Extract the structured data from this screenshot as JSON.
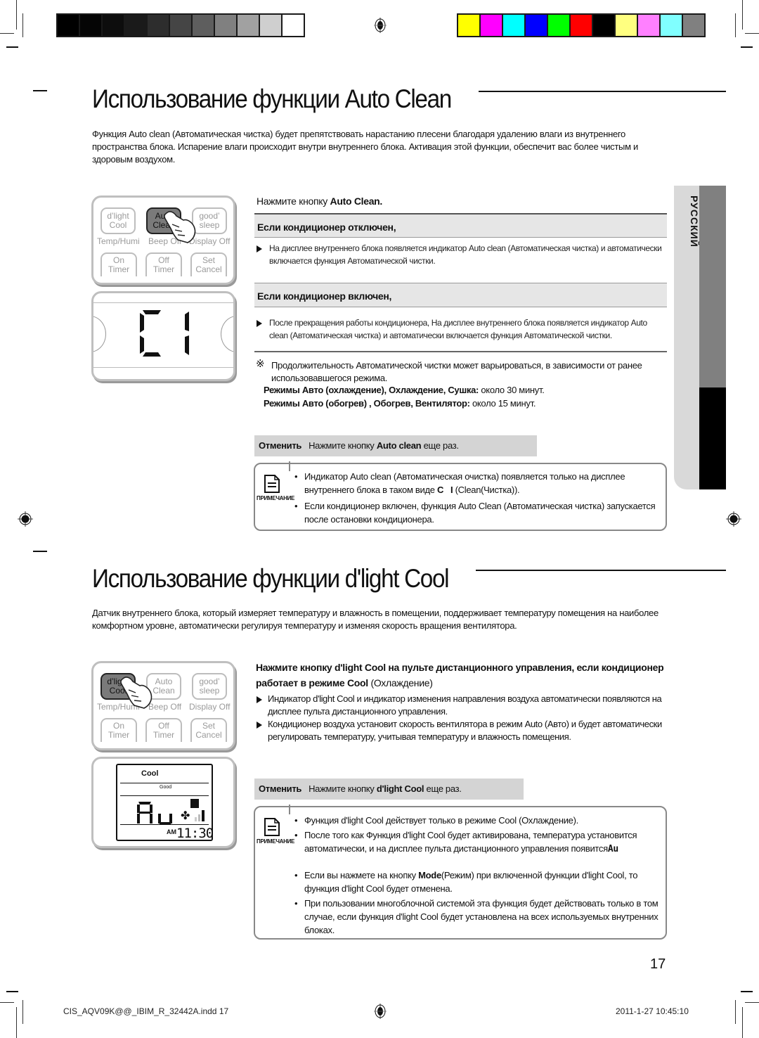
{
  "print_marks": {
    "grayscale_swatches": [
      "#000000",
      "#050505",
      "#0d0d0d",
      "#1a1a1a",
      "#2d2d2d",
      "#454545",
      "#5e5e5e",
      "#808080",
      "#a1a1a1",
      "#cfcfcf",
      "#ffffff"
    ],
    "color_swatches": [
      "#ffff00",
      "#ff00ff",
      "#00ffff",
      "#0000ff",
      "#00ff00",
      "#ff0000",
      "#000000",
      "#ffff80",
      "#ff80ff",
      "#80ffff",
      "#808080"
    ]
  },
  "sidebar": {
    "language": "РУССКИЙ"
  },
  "section1": {
    "title": "Использование функции Auto Clean",
    "intro": "Функция Auto clean (Автоматическая чистка)  будет препятствовать нарастанию плесени благодаря удалению влаги из внутреннего пространства блока. Испарение влаги происходит внутри внутреннего блока. Активация этой функции, обеспечит вас более чистым и здоровым воздухом.",
    "remote": {
      "buttons": [
        {
          "line1": "d’light",
          "line2": "Cool"
        },
        {
          "line1": "Auto",
          "line2": "Clean"
        },
        {
          "line1": "good’",
          "line2": "sleep"
        }
      ],
      "labels": [
        "Temp/Humi",
        "Beep Off",
        "Display Off"
      ],
      "bottom_buttons": [
        {
          "line1": "On",
          "line2": "Timer"
        },
        {
          "line1": "Off",
          "line2": "Timer"
        },
        {
          "line1": "Set",
          "line2": "Cancel"
        }
      ],
      "display_text": "C1"
    },
    "step_prefix": "Нажмите кнопку ",
    "step_button": "Auto Clean.",
    "case_off": {
      "title": "Если кондиционер отключен,",
      "text": "На дисплее внутреннего блока появляется индикатор Auto clean (Автоматическая чистка) и автоматически включается функция Автоматической чистки."
    },
    "case_on": {
      "title": "Если кондиционер включен,",
      "text": "После прекращения работы кондиционера, На дисплее внутреннего блока появляется индикатор Auto clean (Автоматическая чистка) и автоматически включается функция Автоматической чистки."
    },
    "remark": {
      "symbol": "※",
      "text": "Продолжительность Автоматической чистки может варьироваться, в зависимости от ранее использовавшегося режима.",
      "line1_bold": "Режимы Авто (охлаждение), Охлаждение, Сушка:",
      "line1_rest": " около 30 минут.",
      "line2_bold": "Режимы Авто (обогрев) , Обогрев, Вентилятор:",
      "line2_rest": " около 15 минут."
    },
    "cancel": {
      "label": "Отменить",
      "prefix": "Нажмите  кнопку ",
      "button": "Auto clean",
      "suffix": " еще раз."
    },
    "note": {
      "label": "ПРИМЕЧАНИЕ",
      "items": [
        {
          "before": "Индикатор Auto clean (Автоматическая очистка) появляется только на дисплее внутреннего блока в таком виде ",
          "symbol": "C I",
          "after": "(Clean(Чистка))."
        },
        {
          "text": "Если кондиционер включен, функция Auto Clean (Автоматическая чистка) запускается после остановки кондиционера."
        }
      ]
    }
  },
  "section2": {
    "title": "Использование функции d'light Cool",
    "intro": "Датчик внутреннего блока, который измеряет температуру и влажность в помещении, поддерживает  температуру помещения на наиболее комфортном уровне, автоматически регулируя температуру и изменяя скорость вращения вентилятора.",
    "remote": {
      "buttons": [
        {
          "line1": "d’light",
          "line2": "Cool"
        },
        {
          "line1": "Auto",
          "line2": "Clean"
        },
        {
          "line1": "good’",
          "line2": "sleep"
        }
      ],
      "labels": [
        "Temp/Humi",
        "Beep Off",
        "Display Off"
      ],
      "bottom_buttons": [
        {
          "line1": "On",
          "line2": "Timer"
        },
        {
          "line1": "Off",
          "line2": "Timer"
        },
        {
          "line1": "Set",
          "line2": "Cancel"
        }
      ],
      "lcd": {
        "mode": "Cool",
        "icon": "Good",
        "main": "Au",
        "ampm": "AM",
        "time": "11:30"
      }
    },
    "step": {
      "p1": "Нажмите  кнопку ",
      "b1": "d'light Cool",
      "p2": " на пульте дистанционного управления, если кондиционер работает в режиме Cool ",
      "p3": "(Охлаждение)"
    },
    "bullets": [
      "Индикатор d'light Cool и индикатор изменения направления воздуха автоматически появляются на дисплее пульта дистанционного управления.",
      "Кондиционер воздуха установит скорость вентилятора в режим Auto (Авто) и будет автоматически регулировать температуру, учитывая температуру и влажность помещения."
    ],
    "cancel": {
      "label": "Отменить",
      "prefix": "Нажмите  кнопку ",
      "button": "d'light Cool",
      "suffix": " еще раз."
    },
    "note": {
      "label": "ПРИМЕЧАНИЕ",
      "items": [
        {
          "text": "Функция d'light Cool действует только в режиме Cool (Охлаждение)."
        },
        {
          "text": "После того как Функция d'light Cool будет активирована, температура установится  автоматически, и на дисплее пульта дистанционного управления появится",
          "symbol": "Au"
        },
        {
          "before": "Если вы нажмете на кнопку ",
          "bold": "Mode",
          "after": "(Режим) при включенной функции d'light Cool, то функция d'light Cool  будет отменена."
        },
        {
          "text": "При пользовании многоблочной системой эта функция будет действовать только в том случае, если функция d'light Cool будет установлена на всех используемых внутренних блоках."
        }
      ]
    }
  },
  "page_number": "17",
  "footer": {
    "file": "CIS_AQV09K@@_IBIM_R_32442A.indd   17",
    "timestamp": "2011-1-27   10:45:10"
  }
}
